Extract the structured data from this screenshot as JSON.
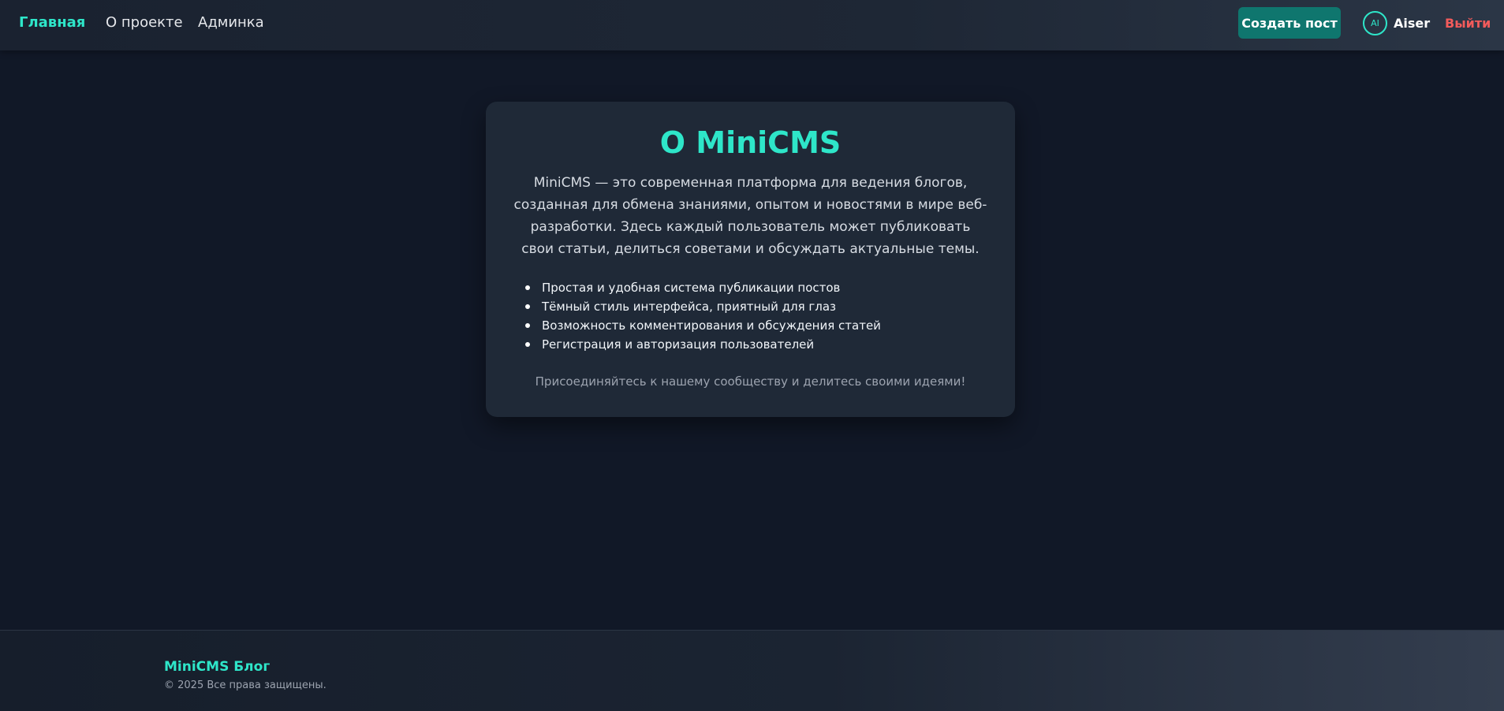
{
  "nav": {
    "home": "Главная",
    "about": "О проекте",
    "admin": "Админка"
  },
  "header": {
    "create_post": "Создать пост",
    "avatar_initials": "AI",
    "username": "Aiser",
    "logout": "Выйти"
  },
  "about_card": {
    "title": "О MiniCMS",
    "description": "MiniCMS — это современная платформа для ведения блогов, созданная для обмена знаниями, опытом и новостями в мире веб-разработки. Здесь каждый пользователь может публиковать свои статьи, делиться советами и обсуждать актуальные темы.",
    "features": [
      "Простая и удобная система публикации постов",
      "Тёмный стиль интерфейса, приятный для глаз",
      "Возможность комментирования и обсуждения статей",
      "Регистрация и авторизация пользователей"
    ],
    "footnote": "Присоединяйтесь к нашему сообществу и делитесь своими идеями!"
  },
  "footer": {
    "title": "MiniCMS Блог",
    "copyright": "© 2025 Все права защищены."
  },
  "colors": {
    "accent": "#2ee6c9",
    "button": "#0f766e",
    "danger": "#f25b5b",
    "background": "#111827",
    "card": "#1f2937"
  }
}
